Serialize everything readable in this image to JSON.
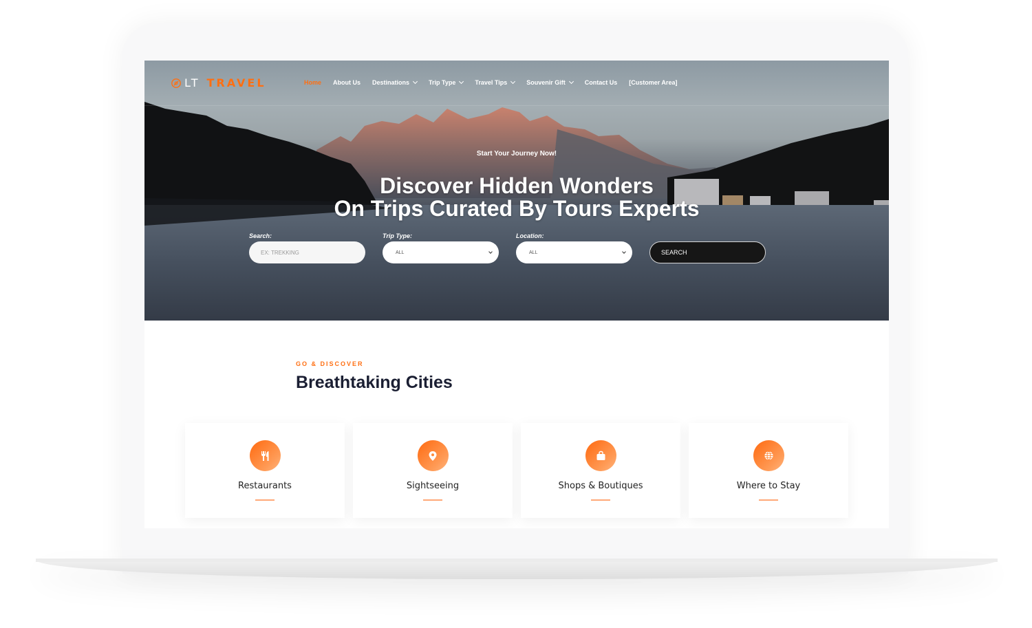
{
  "brand": {
    "logo_prefix": "LT",
    "logo_suffix": "TRAVEL",
    "accent_color": "#ff6f12"
  },
  "nav": {
    "items": [
      {
        "label": "Home",
        "active": true,
        "has_dropdown": false
      },
      {
        "label": "About Us",
        "active": false,
        "has_dropdown": false
      },
      {
        "label": "Destinations",
        "active": false,
        "has_dropdown": true
      },
      {
        "label": "Trip Type",
        "active": false,
        "has_dropdown": true
      },
      {
        "label": "Travel Tips",
        "active": false,
        "has_dropdown": true
      },
      {
        "label": "Souvenir Gift",
        "active": false,
        "has_dropdown": true
      },
      {
        "label": "Contact Us",
        "active": false,
        "has_dropdown": false
      },
      {
        "label": "[Customer Area]",
        "active": false,
        "has_dropdown": false
      }
    ]
  },
  "hero": {
    "subtitle": "Start Your Journey Now!",
    "title_line1": "Discover Hidden Wonders",
    "title_line2": "On Trips Curated By Tours Experts"
  },
  "search_form": {
    "search_label": "Search:",
    "search_placeholder": "EX: TREKKING",
    "search_value": "",
    "trip_type_label": "Trip Type:",
    "trip_type_value": "ALL",
    "location_label": "Location:",
    "location_value": "ALL",
    "submit_label": "SEARCH"
  },
  "section": {
    "eyebrow": "GO & DISCOVER",
    "title": "Breathtaking Cities"
  },
  "cards": [
    {
      "label": "Restaurants",
      "icon": "utensils-icon"
    },
    {
      "label": "Sightseeing",
      "icon": "map-pin-icon"
    },
    {
      "label": "Shops & Boutiques",
      "icon": "shopping-bag-icon"
    },
    {
      "label": "Where to Stay",
      "icon": "globe-icon"
    }
  ]
}
